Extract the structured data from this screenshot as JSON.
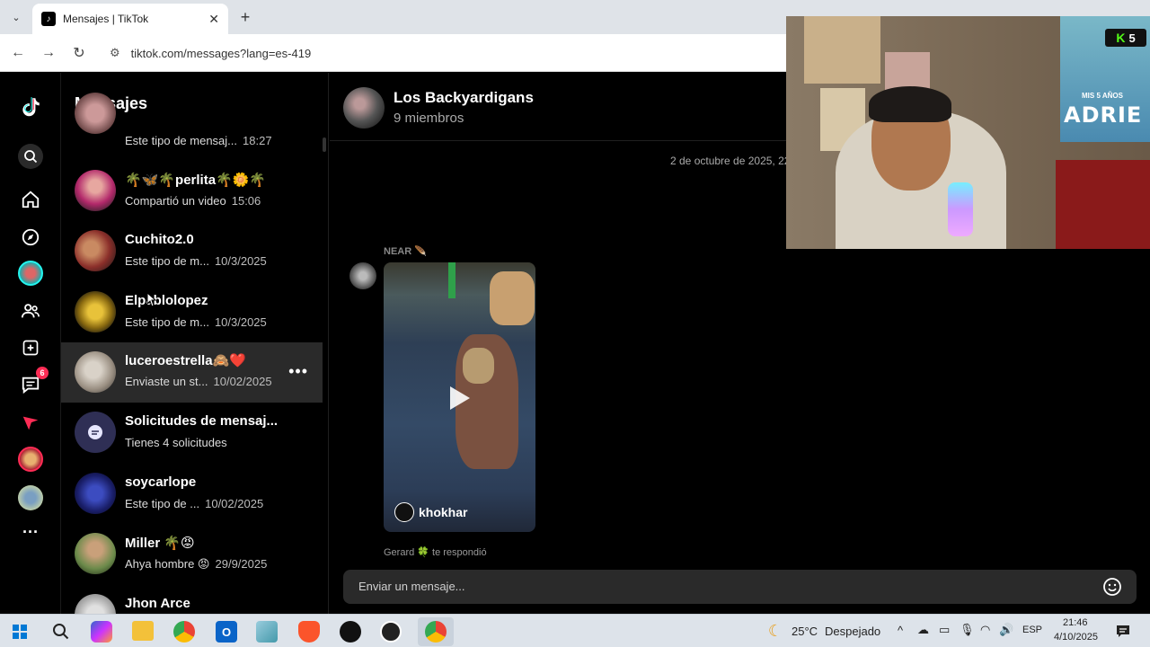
{
  "browser": {
    "tab_title": "Mensajes | TikTok",
    "url": "tiktok.com/messages?lang=es-419"
  },
  "rail": {
    "messages_badge": "6"
  },
  "messages": {
    "heading": "Mensajes",
    "conversations": [
      {
        "name": "",
        "preview": "Este tipo de mensaj...",
        "time": "18:27"
      },
      {
        "name": "🌴🦋🌴perlita🌴🌼🌴",
        "preview": "Compartió un video",
        "time": "15:06"
      },
      {
        "name": "Cuchito2.0",
        "preview": "Este tipo de m...",
        "time": "10/3/2025"
      },
      {
        "name": "Elpablolopez",
        "preview": "Este tipo de m...",
        "time": "10/3/2025"
      },
      {
        "name": "luceroestrella🙈❤️",
        "preview": "Enviaste un st...",
        "time": "10/02/2025"
      },
      {
        "name": "Solicitudes de mensaj...",
        "preview": "Tienes 4 solicitudes",
        "time": ""
      },
      {
        "name": "soycarlope",
        "preview": "Este tipo de ...",
        "time": "10/02/2025"
      },
      {
        "name": "Miller 🌴😡",
        "preview": "Ahya hombre 😡",
        "time": "29/9/2025"
      },
      {
        "name": "Jhon Arce",
        "preview": "",
        "time": ""
      }
    ]
  },
  "chat": {
    "group_name": "Los Backyardigans",
    "members": "9 miembros",
    "date_separator": "2 de octubre de 2025, 22",
    "sender": "NEAR 🪶",
    "video_user": "khokhar",
    "reply_note": "Gerard 🍀 te respondió",
    "composer_placeholder": "Enviar un mensaje..."
  },
  "webcam": {
    "banner_text": "ADRIE",
    "banner_top": "MIS 5 AÑOS",
    "kick_count": "5"
  },
  "taskbar": {
    "weather_temp": "25°C",
    "weather_desc": "Despejado",
    "lang": "ESP",
    "time": "21:46",
    "date": "4/10/2025"
  }
}
